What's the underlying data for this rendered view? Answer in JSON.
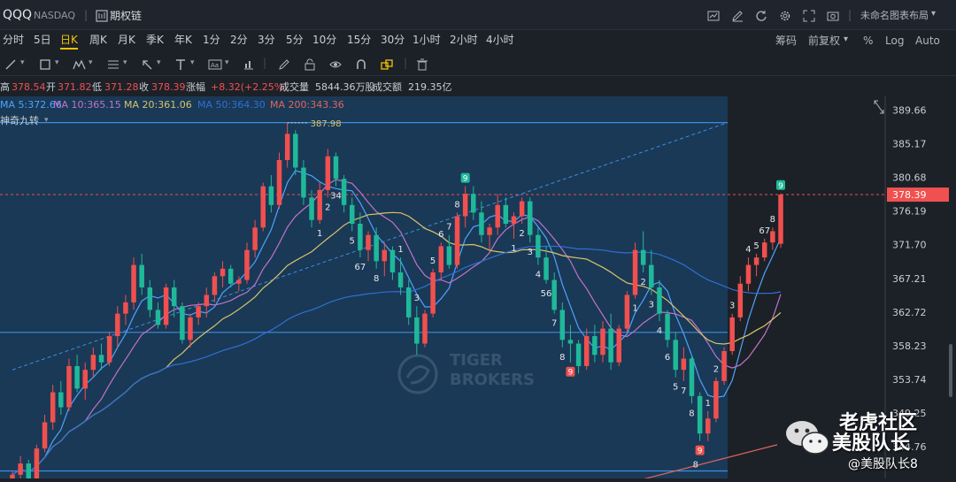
{
  "titlebar": {
    "symbol": "QQQ",
    "exchange": "NASDAQ",
    "divider": "|",
    "options_chain": "期权链",
    "layout_name": "未命名图表布局"
  },
  "timeframes": [
    "分时",
    "5日",
    "日K",
    "周K",
    "月K",
    "季K",
    "年K",
    "1分",
    "2分",
    "3分",
    "5分",
    "10分",
    "15分",
    "30分",
    "1小时",
    "2小时",
    "4小时"
  ],
  "active_timeframe": "日K",
  "right_tools": {
    "chip": "筹码",
    "adjust": "前复权",
    "percent": "%",
    "log": "Log",
    "auto": "Auto"
  },
  "quote": {
    "high_label": "高",
    "high": "378.54",
    "open_label": "开",
    "open": "371.82",
    "low_label": "低",
    "low": "371.28",
    "close_label": "收",
    "close": "378.39",
    "change_label": "涨幅",
    "change": "+8.32(+2.25%)",
    "volume_label": "成交量",
    "volume": "5844.36万股",
    "turnover_label": "成交额",
    "turnover": "219.35亿"
  },
  "ma_legend": {
    "label": "MA",
    "items": [
      {
        "text": "MA 5:372.66",
        "color": "#4da3ff"
      },
      {
        "text": "MA 10:365.15",
        "color": "#c074c8"
      },
      {
        "text": "MA 20:361.06",
        "color": "#d8c36a"
      },
      {
        "text": "MA 50:364.30",
        "color": "#2f6fd6"
      },
      {
        "text": "MA 200:343.36",
        "color": "#e0665d"
      }
    ]
  },
  "indicator_name": "神奇九转",
  "colors": {
    "up": "#f0504f",
    "down": "#1fb99a",
    "bg": "#1c2128",
    "panel": "#1a3d5e",
    "accent": "#f2c200"
  },
  "chart_data": {
    "type": "candlestick",
    "symbol": "QQQ",
    "period": "日K",
    "y_ticks": [
      389.66,
      385.17,
      380.68,
      376.19,
      371.7,
      367.21,
      362.72,
      358.23,
      353.74,
      349.25,
      344.76
    ],
    "ylim": [
      340.5,
      391.5
    ],
    "last_price": 378.39,
    "high_marker": 387.98,
    "candles": [
      [
        340.0,
        341.5,
        339.0,
        341.0
      ],
      [
        341.0,
        343.5,
        340.0,
        342.5
      ],
      [
        342.5,
        343.0,
        339.5,
        340.5
      ],
      [
        340.5,
        345.0,
        340.0,
        344.5
      ],
      [
        344.5,
        349.0,
        344.0,
        348.0
      ],
      [
        348.0,
        353.0,
        347.0,
        352.0
      ],
      [
        352.0,
        353.5,
        349.0,
        350.0
      ],
      [
        350.0,
        356.5,
        349.5,
        355.5
      ],
      [
        355.5,
        357.0,
        352.0,
        352.5
      ],
      [
        352.5,
        356.0,
        351.0,
        355.0
      ],
      [
        355.0,
        358.0,
        354.0,
        357.0
      ],
      [
        357.0,
        358.5,
        355.0,
        356.0
      ],
      [
        356.0,
        360.0,
        355.5,
        359.5
      ],
      [
        359.5,
        363.5,
        358.0,
        362.5
      ],
      [
        362.5,
        365.0,
        361.0,
        364.0
      ],
      [
        364.0,
        370.0,
        363.0,
        369.0
      ],
      [
        369.0,
        370.5,
        365.0,
        366.0
      ],
      [
        366.0,
        367.0,
        362.0,
        363.0
      ],
      [
        363.0,
        364.0,
        360.5,
        361.0
      ],
      [
        361.0,
        366.5,
        360.5,
        366.0
      ],
      [
        366.0,
        367.0,
        362.0,
        363.5
      ],
      [
        363.5,
        364.0,
        358.5,
        359.0
      ],
      [
        359.0,
        362.5,
        358.0,
        362.0
      ],
      [
        362.0,
        364.0,
        361.0,
        363.5
      ],
      [
        363.5,
        366.0,
        362.0,
        365.0
      ],
      [
        365.0,
        368.0,
        364.0,
        367.5
      ],
      [
        367.5,
        369.5,
        366.0,
        368.5
      ],
      [
        368.5,
        369.0,
        366.0,
        366.5
      ],
      [
        366.5,
        367.5,
        365.5,
        367.0
      ],
      [
        367.0,
        372.0,
        366.5,
        371.0
      ],
      [
        371.0,
        375.0,
        370.0,
        374.0
      ],
      [
        374.0,
        380.0,
        373.5,
        379.5
      ],
      [
        379.5,
        381.0,
        376.0,
        377.0
      ],
      [
        377.0,
        384.0,
        376.5,
        383.0
      ],
      [
        383.0,
        387.98,
        382.0,
        386.5
      ],
      [
        386.5,
        387.0,
        381.0,
        382.0
      ],
      [
        382.0,
        383.0,
        377.0,
        378.0
      ],
      [
        378.0,
        379.0,
        374.0,
        375.0
      ],
      [
        375.0,
        380.0,
        374.5,
        379.0
      ],
      [
        379.0,
        384.5,
        378.0,
        383.5
      ],
      [
        383.5,
        384.0,
        379.5,
        380.5
      ],
      [
        380.5,
        381.0,
        376.0,
        377.0
      ],
      [
        377.0,
        378.0,
        373.5,
        374.5
      ],
      [
        374.5,
        376.0,
        370.0,
        371.0
      ],
      [
        371.0,
        373.5,
        369.5,
        373.0
      ],
      [
        373.0,
        374.0,
        368.5,
        369.5
      ],
      [
        369.5,
        372.0,
        367.5,
        371.0
      ],
      [
        371.0,
        371.5,
        367.0,
        368.0
      ],
      [
        368.0,
        370.0,
        365.0,
        366.0
      ],
      [
        366.0,
        367.0,
        361.0,
        362.0
      ],
      [
        362.0,
        363.5,
        357.0,
        358.5
      ],
      [
        358.5,
        363.0,
        358.0,
        362.5
      ],
      [
        362.5,
        368.5,
        362.0,
        368.0
      ],
      [
        368.0,
        372.0,
        367.0,
        371.5
      ],
      [
        371.5,
        373.0,
        368.5,
        369.0
      ],
      [
        369.0,
        376.0,
        368.5,
        375.5
      ],
      [
        375.5,
        379.5,
        374.0,
        378.5
      ],
      [
        378.5,
        379.5,
        375.0,
        376.0
      ],
      [
        376.0,
        377.5,
        372.0,
        373.0
      ],
      [
        373.0,
        374.5,
        371.0,
        374.0
      ],
      [
        374.0,
        378.5,
        373.0,
        377.0
      ],
      [
        377.0,
        378.0,
        374.0,
        374.5
      ],
      [
        374.5,
        376.0,
        372.5,
        375.5
      ],
      [
        375.5,
        378.0,
        374.5,
        377.5
      ],
      [
        377.5,
        378.0,
        372.0,
        373.0
      ],
      [
        373.0,
        374.0,
        369.0,
        370.0
      ],
      [
        370.0,
        371.5,
        366.5,
        367.0
      ],
      [
        367.0,
        368.0,
        362.5,
        363.0
      ],
      [
        363.0,
        364.0,
        358.0,
        359.0
      ],
      [
        359.0,
        361.0,
        356.0,
        358.5
      ],
      [
        358.5,
        359.0,
        354.5,
        355.5
      ],
      [
        355.5,
        360.5,
        355.0,
        359.5
      ],
      [
        359.5,
        361.0,
        356.0,
        357.0
      ],
      [
        357.0,
        361.5,
        356.0,
        360.5
      ],
      [
        360.5,
        362.5,
        355.0,
        356.0
      ],
      [
        356.0,
        361.0,
        355.5,
        360.5
      ],
      [
        360.5,
        365.5,
        360.0,
        365.0
      ],
      [
        365.0,
        372.0,
        364.5,
        371.0
      ],
      [
        371.0,
        373.5,
        368.0,
        369.0
      ],
      [
        369.0,
        371.0,
        365.0,
        366.0
      ],
      [
        366.0,
        367.0,
        361.5,
        362.5
      ],
      [
        362.5,
        363.0,
        358.0,
        359.0
      ],
      [
        359.0,
        360.0,
        354.0,
        355.0
      ],
      [
        355.0,
        358.0,
        353.5,
        356.5
      ],
      [
        356.5,
        357.0,
        350.5,
        351.5
      ],
      [
        351.5,
        352.0,
        345.5,
        346.5
      ],
      [
        346.5,
        349.5,
        345.5,
        348.5
      ],
      [
        348.5,
        354.0,
        348.0,
        353.5
      ],
      [
        353.5,
        358.0,
        353.0,
        357.5
      ],
      [
        357.5,
        362.5,
        357.0,
        362.0
      ],
      [
        362.0,
        367.5,
        361.5,
        366.5
      ],
      [
        366.5,
        370.0,
        365.5,
        369.0
      ],
      [
        369.0,
        370.5,
        367.5,
        370.0
      ],
      [
        370.0,
        372.5,
        369.5,
        372.0
      ],
      [
        372.0,
        374.0,
        371.0,
        373.5
      ],
      [
        371.82,
        378.54,
        371.28,
        378.39
      ]
    ],
    "nine_labels": [
      {
        "i": 38,
        "text": "1",
        "pos": "below"
      },
      {
        "i": 39,
        "text": "2",
        "pos": "below"
      },
      {
        "i": 40,
        "text": "34",
        "pos": "below"
      },
      {
        "i": 42,
        "text": "5",
        "pos": "below"
      },
      {
        "i": 43,
        "text": "67",
        "pos": "below"
      },
      {
        "i": 45,
        "text": "8",
        "pos": "below"
      },
      {
        "i": 48,
        "text": "1",
        "pos": "above"
      },
      {
        "i": 50,
        "text": "3",
        "pos": "above"
      },
      {
        "i": 52,
        "text": "5",
        "pos": "above"
      },
      {
        "i": 53,
        "text": "6",
        "pos": "above"
      },
      {
        "i": 54,
        "text": "7",
        "pos": "above"
      },
      {
        "i": 55,
        "text": "8",
        "pos": "above"
      },
      {
        "i": 56,
        "text": "9",
        "pos": "above",
        "box": true
      },
      {
        "i": 62,
        "text": "1",
        "pos": "below"
      },
      {
        "i": 63,
        "text": "2",
        "pos": "below"
      },
      {
        "i": 64,
        "text": "3",
        "pos": "below"
      },
      {
        "i": 65,
        "text": "4",
        "pos": "below"
      },
      {
        "i": 66,
        "text": "56",
        "pos": "below"
      },
      {
        "i": 67,
        "text": "7",
        "pos": "below"
      },
      {
        "i": 68,
        "text": "8",
        "pos": "below"
      },
      {
        "i": 69,
        "text": "9",
        "pos": "below",
        "box": true
      },
      {
        "i": 77,
        "text": "1",
        "pos": "below"
      },
      {
        "i": 78,
        "text": "2",
        "pos": "below"
      },
      {
        "i": 79,
        "text": "3",
        "pos": "below"
      },
      {
        "i": 80,
        "text": "4",
        "pos": "below"
      },
      {
        "i": 81,
        "text": "6",
        "pos": "below"
      },
      {
        "i": 82,
        "text": "5",
        "pos": "below"
      },
      {
        "i": 83,
        "text": "7",
        "pos": "below"
      },
      {
        "i": 84,
        "text": "8",
        "pos": "below"
      },
      {
        "i": 85,
        "text": "9",
        "pos": "below",
        "box": true
      },
      {
        "i": 86,
        "text": "1",
        "pos": "above"
      },
      {
        "i": 87,
        "text": "2",
        "pos": "above"
      },
      {
        "i": 89,
        "text": "3",
        "pos": "above"
      },
      {
        "i": 91,
        "text": "4",
        "pos": "above"
      },
      {
        "i": 92,
        "text": "5",
        "pos": "above"
      },
      {
        "i": 93,
        "text": "67",
        "pos": "above"
      },
      {
        "i": 94,
        "text": "8",
        "pos": "above"
      },
      {
        "i": 95,
        "text": "9",
        "pos": "above",
        "box": true
      }
    ],
    "h_lines": [
      388.0,
      360.0,
      341.5
    ],
    "dash_line": {
      "from": [
        0,
        355.0
      ],
      "to": [
        95,
        388.0
      ]
    },
    "extra_bottom_label": "8"
  },
  "watermark": {
    "line1": "TIGER",
    "line2": "BROKERS"
  },
  "social": {
    "title1": "老虎社区",
    "title2": "美股队长",
    "handle": "@美股队长8"
  }
}
